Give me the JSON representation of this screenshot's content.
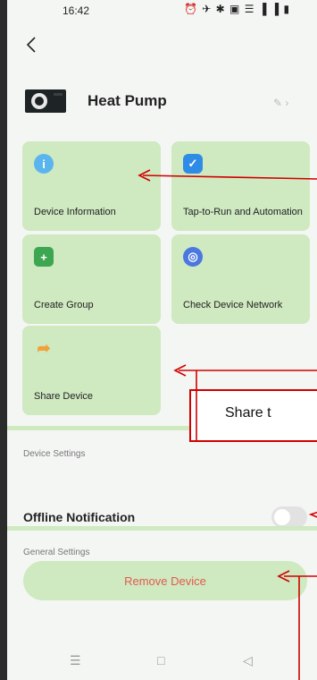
{
  "status_bar": {
    "time": "16:42",
    "icons_text": "⏰ ✈ ✱ ▣ ☰ ▐ ▐ ▮"
  },
  "header": {
    "title": "Heat Pump"
  },
  "tiles": [
    {
      "label": "Device Information"
    },
    {
      "label": "Tap-to-Run and Automation"
    },
    {
      "label": "Create Group"
    },
    {
      "label": "Check Device Network"
    },
    {
      "label": "Share Device"
    }
  ],
  "sections": {
    "device_settings": "Device Settings",
    "general_settings": "General Settings"
  },
  "offline_notification": {
    "label": "Offline Notification",
    "enabled": false
  },
  "remove_button": {
    "label": "Remove Device"
  },
  "annotation": {
    "text": "Share t"
  },
  "colors": {
    "tile_green": "#cfe9c0",
    "remove_text": "#e35a4f",
    "annotation_red": "#d00000"
  }
}
